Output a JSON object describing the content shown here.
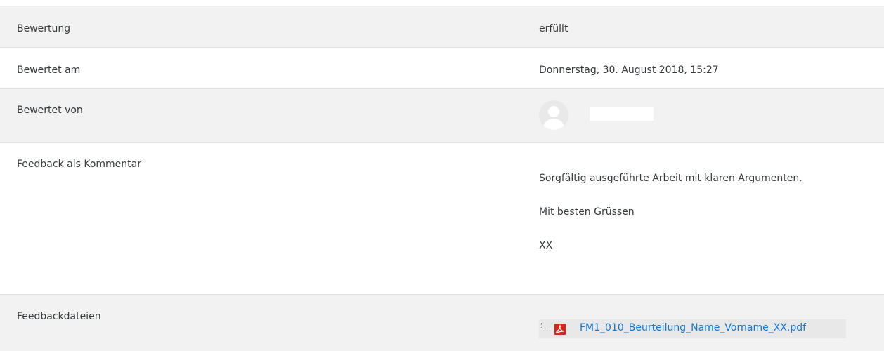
{
  "rows": {
    "grade": {
      "label": "Bewertung",
      "value": "erfüllt"
    },
    "graded_on": {
      "label": "Bewertet am",
      "value": "Donnerstag, 30. August 2018, 15:27"
    },
    "graded_by": {
      "label": "Bewertet von",
      "avatar_icon": "user-avatar-icon"
    },
    "comment": {
      "label": "Feedback als Kommentar",
      "lines": [
        "Sorgfältig ausgeführte Arbeit mit klaren Argumenten.",
        "Mit besten Grüssen",
        "XX"
      ]
    },
    "files": {
      "label": "Feedbackdateien",
      "file_name": "FM1_010_Beurteilung_Name_Vorname_XX.pdf",
      "file_icon": "pdf-icon"
    }
  },
  "colors": {
    "stripe": "#f2f2f2",
    "border": "#dee2e6",
    "link": "#1177d1",
    "pdf": "#d7261e"
  }
}
